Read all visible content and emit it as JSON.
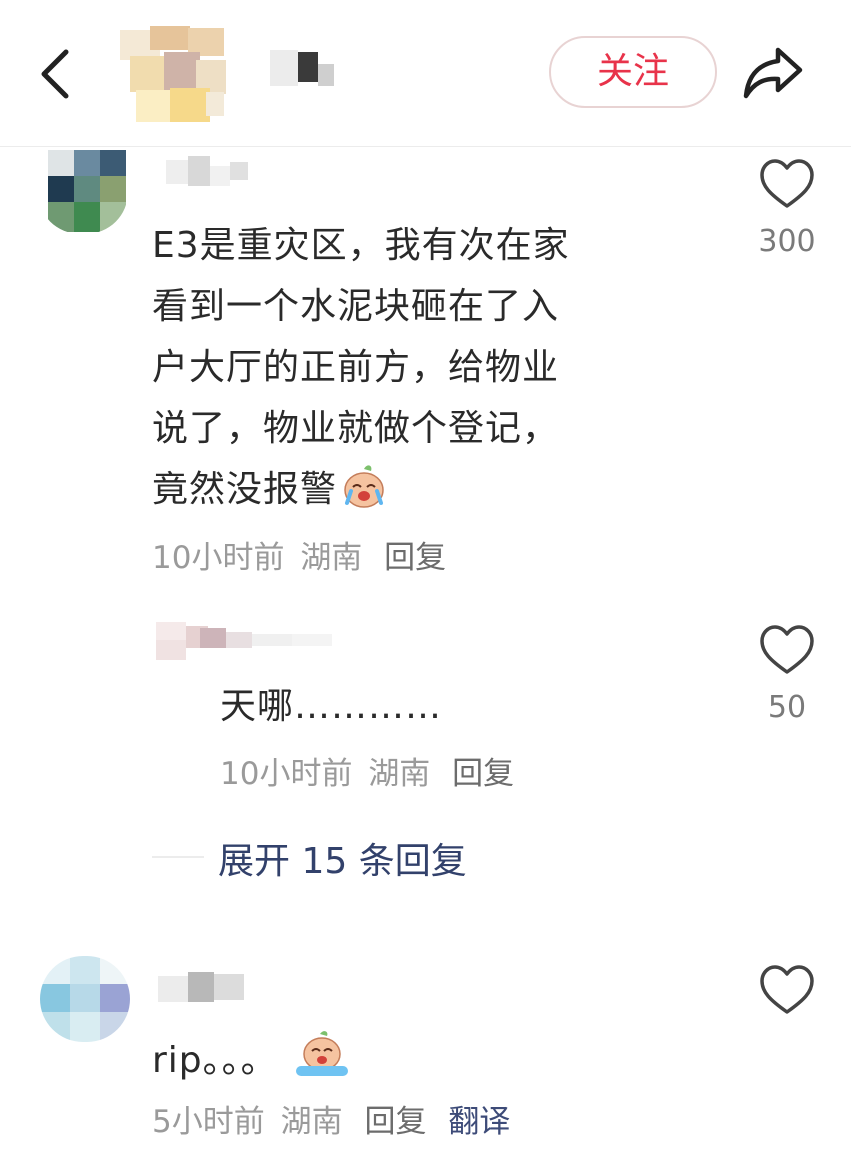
{
  "header": {
    "follow_label": "关注"
  },
  "comments": [
    {
      "lines": [
        "E3是重灾区，我有次在家",
        "看到一个水泥块砸在了入",
        "户大厅的正前方，给物业",
        "说了，物业就做个登记，",
        "竟然没报警"
      ],
      "time": "10小时前",
      "location": "湖南",
      "reply_label": "回复",
      "likes": "300"
    },
    {
      "text": "rip。。。",
      "time": "5小时前",
      "location": "湖南",
      "reply_label": "回复",
      "translate_label": "翻译"
    }
  ],
  "reply": {
    "text": "天哪…………",
    "time": "10小时前",
    "location": "湖南",
    "reply_label": "回复",
    "likes": "50"
  },
  "expand_label": "展开 15 条回复",
  "icons": {
    "back": "back-arrow-icon",
    "share": "share-icon",
    "like": "heart-outline-icon",
    "emoji": "crying-face-emoji-icon"
  },
  "colors": {
    "follow": "#e8334a",
    "expand": "#32416b",
    "meta": "#9a9a9a"
  }
}
